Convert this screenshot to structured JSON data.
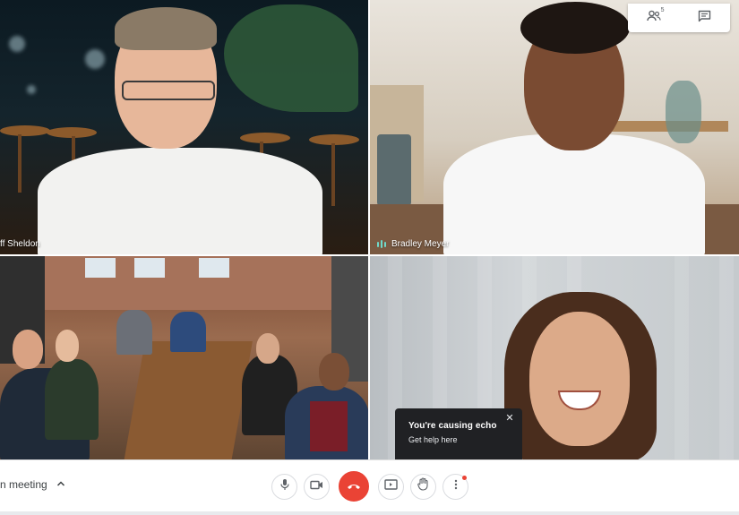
{
  "tiles": [
    {
      "id": "tile-1",
      "name": "ff Sheldon",
      "speaking": false
    },
    {
      "id": "tile-2",
      "name": "Bradley Meyer",
      "speaking": true
    },
    {
      "id": "tile-3",
      "name": "",
      "speaking": false
    },
    {
      "id": "tile-4",
      "name": "",
      "speaking": false
    }
  ],
  "top_panel": {
    "participants_count": "5",
    "participants_icon": "people-icon",
    "chat_icon": "chat-icon"
  },
  "toast": {
    "title": "You're causing echo",
    "link": "Get help here",
    "close_icon": "close-icon"
  },
  "bottom_bar": {
    "meeting_label": "n meeting",
    "expand_icon": "chevron-up-icon",
    "controls": [
      {
        "id": "mic",
        "icon": "microphone-icon"
      },
      {
        "id": "camera",
        "icon": "camera-icon"
      },
      {
        "id": "hangup",
        "icon": "phone-hangup-icon"
      },
      {
        "id": "present",
        "icon": "present-screen-icon"
      },
      {
        "id": "raise-hand",
        "icon": "hand-icon"
      },
      {
        "id": "more",
        "icon": "more-vert-icon",
        "notification_dot": true
      }
    ]
  },
  "colors": {
    "hangup_red": "#ea4335",
    "toast_bg": "#202124",
    "speaking_indicator": "#6fd9c9",
    "icon_gray": "#5f6368"
  }
}
